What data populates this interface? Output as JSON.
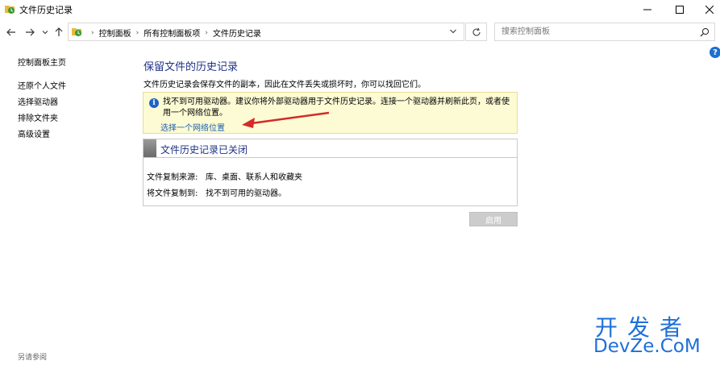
{
  "window": {
    "title": "文件历史记录"
  },
  "navigation": {
    "breadcrumbs": [
      "控制面板",
      "所有控制面板项",
      "文件历史记录"
    ]
  },
  "search": {
    "placeholder": "搜索控制面板"
  },
  "sidebar": {
    "items": [
      {
        "label": "控制面板主页"
      },
      {
        "label": "还原个人文件"
      },
      {
        "label": "选择驱动器"
      },
      {
        "label": "排除文件夹"
      },
      {
        "label": "高级设置"
      }
    ],
    "see_also": "另请参阅"
  },
  "main": {
    "heading": "保留文件的历史记录",
    "description": "文件历史记录会保存文件的副本，因此在文件丢失或损坏时，你可以找回它们。",
    "info": {
      "message": "找不到可用驱动器。建议你将外部驱动器用于文件历史记录。连接一个驱动器并刷新此页，或者使用一个网络位置。",
      "link": "选择一个网络位置"
    },
    "status": {
      "title": "文件历史记录已关闭",
      "rows": [
        {
          "label": "文件复制来源:",
          "value": "库、桌面、联系人和收藏夹"
        },
        {
          "label": "将文件复制到:",
          "value": "找不到可用的驱动器。"
        }
      ]
    },
    "enable_button": "启用"
  },
  "watermark": {
    "line1": "开发者",
    "line2": "DevZe.CoM"
  },
  "colors": {
    "heading": "#1e3287",
    "link": "#1a5fb4",
    "info_bg": "#fdfbd4",
    "annotation_arrow": "#d42a2a",
    "watermark": "#1e6fd8"
  }
}
